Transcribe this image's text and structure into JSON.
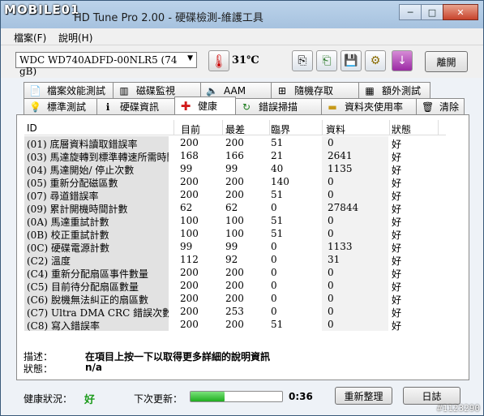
{
  "window": {
    "logo_text": "MOBILE01",
    "title": "HD Tune Pro 2.00 - 硬碟檢測-維護工具",
    "minimize": "─",
    "maximize": "□",
    "close": "✕"
  },
  "menu": {
    "file": "檔案(F)",
    "help": "說明(H)"
  },
  "toolbar": {
    "drive": "WDC WD740ADFD-00NLR5 (74 gB)",
    "temperature": "31℃",
    "exit_label": "離開",
    "icons": [
      "copy-icon",
      "copy-all-icon",
      "save-icon",
      "screenshot-icon",
      "download-icon"
    ]
  },
  "tabs_top": [
    "檔案效能測試",
    "磁碟監視",
    "AAM",
    "隨機存取",
    "額外測試"
  ],
  "tabs_bottom": [
    "標準測試",
    "硬碟資訊",
    "健康",
    "錯誤掃描",
    "資料夾使用率",
    "清除"
  ],
  "active_tab": "健康",
  "table": {
    "headers": [
      "ID",
      "目前",
      "最差",
      "臨界",
      "資料",
      "狀態"
    ],
    "rows": [
      [
        "(01) 底層資料讀取錯誤率",
        "200",
        "200",
        "51",
        "0",
        "好"
      ],
      [
        "(03) 馬達旋轉到標準轉速所需時間",
        "168",
        "166",
        "21",
        "2641",
        "好"
      ],
      [
        "(04) 馬達開始/ 停止次數",
        "99",
        "99",
        "40",
        "1135",
        "好"
      ],
      [
        "(05) 重新分配磁區數",
        "200",
        "200",
        "140",
        "0",
        "好"
      ],
      [
        "(07) 尋道錯誤率",
        "200",
        "200",
        "51",
        "0",
        "好"
      ],
      [
        "(09) 累計開機時間計數",
        "62",
        "62",
        "0",
        "27844",
        "好"
      ],
      [
        "(0A) 馬達重試計數",
        "100",
        "100",
        "51",
        "0",
        "好"
      ],
      [
        "(0B) 校正重試計數",
        "100",
        "100",
        "51",
        "0",
        "好"
      ],
      [
        "(0C) 硬碟電源計數",
        "99",
        "99",
        "0",
        "1133",
        "好"
      ],
      [
        "(C2) 溫度",
        "112",
        "92",
        "0",
        "31",
        "好"
      ],
      [
        "(C4) 重新分配扇區事件數量",
        "200",
        "200",
        "0",
        "0",
        "好"
      ],
      [
        "(C5) 目前待分配扇區數量",
        "200",
        "200",
        "0",
        "0",
        "好"
      ],
      [
        "(C6) 脫機無法糾正的扇區數",
        "200",
        "200",
        "0",
        "0",
        "好"
      ],
      [
        "(C7) Ultra DMA CRC 錯誤次數",
        "200",
        "253",
        "0",
        "0",
        "好"
      ],
      [
        "(C8) 寫入錯誤率",
        "200",
        "200",
        "51",
        "0",
        "好"
      ]
    ]
  },
  "description": {
    "label": "描述：",
    "value": "在項目上按一下以取得更多詳細的說明資訊",
    "status_label": "狀態：",
    "status_value": "n/a"
  },
  "footer": {
    "health_label": "健康狀況：",
    "health_value": "好",
    "health_color": "#1a9a1a",
    "next_update_label": "下次更新：",
    "progress": 0.37,
    "countdown": "0:36",
    "refresh_label": "重新整理",
    "log_label": "日誌"
  },
  "watermark": "#1123290"
}
